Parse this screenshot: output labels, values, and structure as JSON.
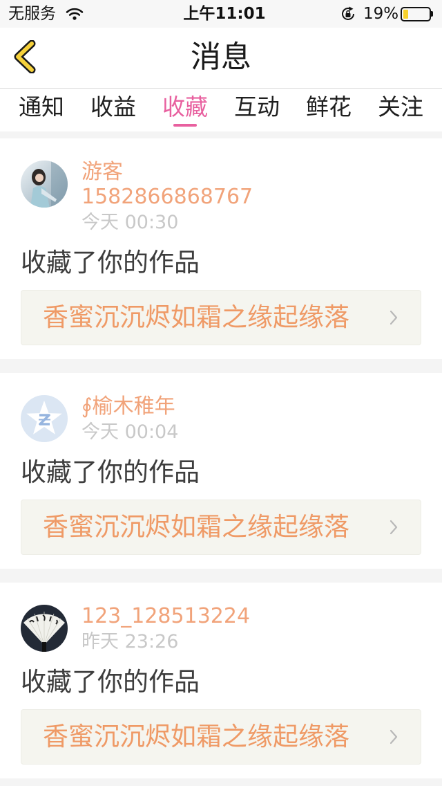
{
  "status_bar": {
    "carrier": "无服务",
    "time": "上午11:01",
    "battery_text": "19%",
    "battery_level": 0.19,
    "icons": [
      "wifi-icon",
      "rotation-lock-icon",
      "battery-icon"
    ]
  },
  "nav": {
    "title": "消息",
    "back_icon": "back-chevron-icon"
  },
  "tabs": [
    {
      "label": "通知",
      "active": false
    },
    {
      "label": "收益",
      "active": false
    },
    {
      "label": "收藏",
      "active": true
    },
    {
      "label": "互动",
      "active": false
    },
    {
      "label": "鲜花",
      "active": false
    },
    {
      "label": "关注",
      "active": false
    }
  ],
  "messages": [
    {
      "avatar": "user-photo-avatar",
      "name": "游客",
      "phone": "1582866868767",
      "time": "今天 00:30",
      "action": "收藏了你的作品",
      "work_title": "香蜜沉沉烬如霜之缘起缘落"
    },
    {
      "avatar": "default-avatar-icon",
      "name": "∮榆木稚年",
      "time": "今天 00:04",
      "action": "收藏了你的作品",
      "work_title": "香蜜沉沉烬如霜之缘起缘落"
    },
    {
      "avatar": "fan-photo-avatar",
      "name": "123_128513224",
      "time": "昨天 23:26",
      "action": "收藏了你的作品",
      "work_title": "香蜜沉沉烬如霜之缘起缘落"
    }
  ],
  "colors": {
    "accent_pink": "#e8609f",
    "name_orange": "#f1a37a",
    "work_orange": "#ef9a66",
    "time_gray": "#c8c8c8",
    "text_dark": "#3d3d3d",
    "back_yellow": "#f6d13a",
    "battery_yellow": "#f7d12b"
  }
}
